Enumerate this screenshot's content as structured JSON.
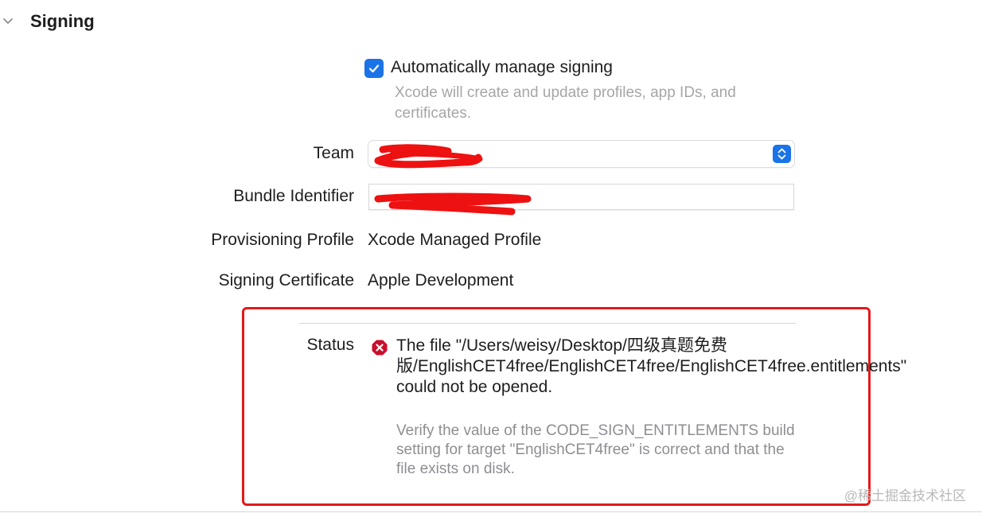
{
  "section": {
    "title": "Signing"
  },
  "auto_signing": {
    "label": "Automatically manage signing",
    "checked": true,
    "helper": "Xcode will create and update profiles, app IDs, and certificates."
  },
  "team": {
    "label": "Team"
  },
  "bundle_identifier": {
    "label": "Bundle Identifier"
  },
  "provisioning_profile": {
    "label": "Provisioning Profile",
    "value": "Xcode Managed Profile"
  },
  "signing_certificate": {
    "label": "Signing Certificate",
    "value": "Apple Development"
  },
  "status": {
    "label": "Status",
    "message": "The file \"/Users/weisy/Desktop/四级真题免费版/EnglishCET4free/EnglishCET4free/EnglishCET4free.entitlements\" could not be opened.",
    "hint": "Verify the value of the CODE_SIGN_ENTITLEMENTS build setting for target \"EnglishCET4free\" is correct and that the file exists on disk."
  },
  "watermark": "@稀土掘金技术社区",
  "colors": {
    "accent": "#1a73e8",
    "error": "#c8102e",
    "annotation": "#e21a1a"
  }
}
